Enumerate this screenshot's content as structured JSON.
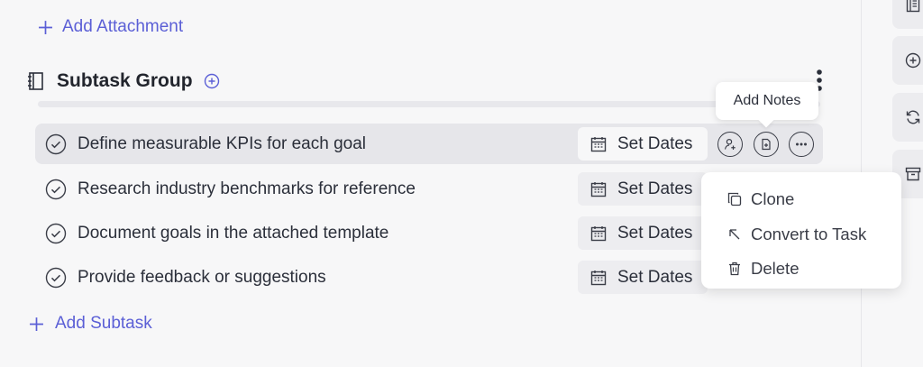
{
  "attachments": {
    "add_label": "Add Attachment"
  },
  "subtask_group": {
    "title": "Subtask Group",
    "tooltip": "Add Notes",
    "rows": [
      {
        "label": "Define measurable KPIs for each goal",
        "dates_label": "Set Dates"
      },
      {
        "label": "Research industry benchmarks for reference",
        "dates_label": "Set Dates"
      },
      {
        "label": "Document goals in the attached template",
        "dates_label": "Set Dates"
      },
      {
        "label": "Provide feedback or suggestions",
        "dates_label": "Set Dates"
      }
    ],
    "add_subtask_label": "Add Subtask"
  },
  "context_menu": {
    "items": [
      {
        "label": "Clone",
        "icon": "clone-icon"
      },
      {
        "label": "Convert to Task",
        "icon": "arrow-up-left-icon"
      },
      {
        "label": "Delete",
        "icon": "trash-icon"
      }
    ]
  },
  "colors": {
    "accent": "#5b5fd6",
    "text": "#2b2f3a",
    "active_row": "#e6e6ea"
  }
}
